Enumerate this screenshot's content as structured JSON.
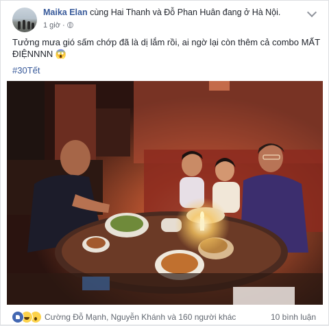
{
  "post": {
    "author": "Maika Elan",
    "header_rest": "cùng Hai Thanh và Đỗ Phan Huân đang ở Hà Nội.",
    "time": "1 giờ",
    "separator": "·",
    "privacy_icon": "globe-icon",
    "menu_icon": "chevron-down-icon",
    "text": "Tưởng mưa gió sấm chớp đã là dị lắm rồi, ai ngờ lại còn thêm cả combo MẤT ĐIỆNNNN 😱",
    "hashtag": "#30Tết"
  },
  "footer": {
    "reaction_icons": [
      "like-icon",
      "haha-icon",
      "wow-icon"
    ],
    "likers": "Cường Đỗ Mạnh, Nguyễn Khánh và 160 người khác",
    "comments": "10 bình luận"
  },
  "colors": {
    "link": "#365899",
    "secondary": "#616770",
    "like_blue": "#4267b2",
    "emoji_yellow": "#fcd24b"
  }
}
